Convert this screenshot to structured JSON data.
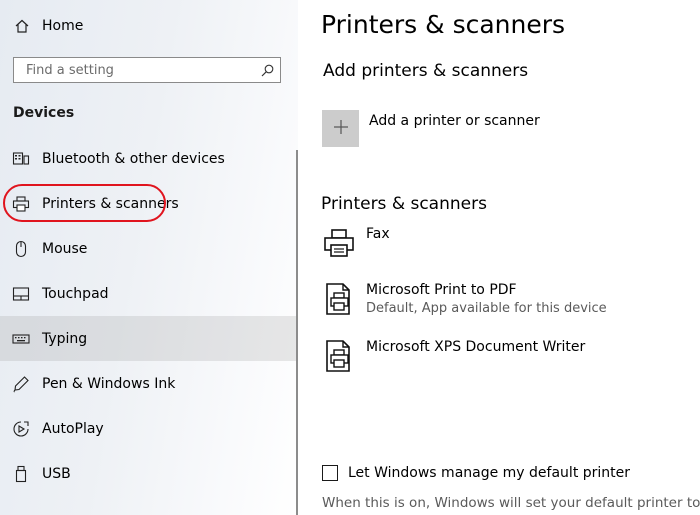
{
  "sidebar": {
    "home_label": "Home",
    "search_placeholder": "Find a setting",
    "section_title": "Devices",
    "items": [
      {
        "label": "Bluetooth & other devices",
        "icon": "bluetooth-devices-icon"
      },
      {
        "label": "Printers & scanners",
        "icon": "printer-icon"
      },
      {
        "label": "Mouse",
        "icon": "mouse-icon"
      },
      {
        "label": "Touchpad",
        "icon": "touchpad-icon"
      },
      {
        "label": "Typing",
        "icon": "keyboard-icon"
      },
      {
        "label": "Pen & Windows Ink",
        "icon": "pen-icon"
      },
      {
        "label": "AutoPlay",
        "icon": "autoplay-icon"
      },
      {
        "label": "USB",
        "icon": "usb-icon"
      }
    ],
    "annotation_color": "#e0141e"
  },
  "main": {
    "title": "Printers & scanners",
    "add_section_title": "Add printers & scanners",
    "add_button_label": "Add a printer or scanner",
    "list_section_title": "Printers & scanners",
    "printers": [
      {
        "name": "Fax",
        "status": ""
      },
      {
        "name": "Microsoft Print to PDF",
        "status": "Default, App available for this device"
      },
      {
        "name": "Microsoft XPS Document Writer",
        "status": ""
      }
    ],
    "checkbox_label": "Let Windows manage my default printer",
    "checkbox_checked": false,
    "help_text": "When this is on, Windows will set your default printer to be"
  }
}
